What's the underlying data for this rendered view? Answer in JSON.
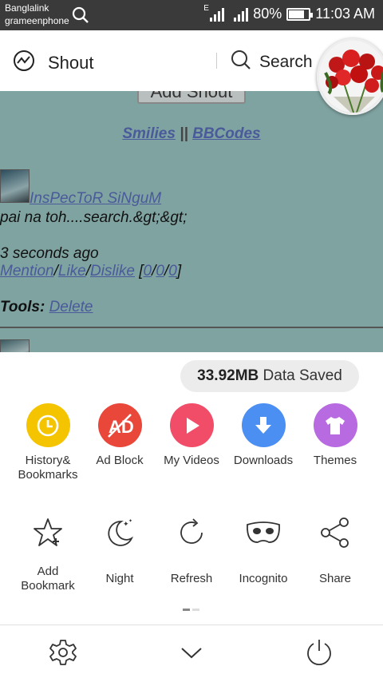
{
  "status_bar": {
    "carrier_1": "Banglalink",
    "carrier_2": "grameenphone",
    "network_type": "E",
    "battery": "80%",
    "battery_level": 0.8,
    "time": "11:03 AM"
  },
  "toolbar": {
    "title": "Shout",
    "search_label": "Search"
  },
  "page": {
    "add_shout_label": "Add Shout",
    "smilies_link": "Smilies",
    "separator": " || ",
    "bbcodes_link": "BBCodes",
    "post": {
      "username": "InsPecToR SiNguM",
      "text": "pai na toh....search.&gt;&gt;",
      "time": "3 seconds ago",
      "mention": "Mention",
      "like": "Like",
      "dislike": "Dislike",
      "slash": "/",
      "open_bracket": " [",
      "close_bracket": "]",
      "count_mention": "0",
      "count_like": "0",
      "count_dislike": "0",
      "tools_label": "Tools:",
      "delete": "Delete"
    }
  },
  "sheet": {
    "data_saved_amount": "33.92MB",
    "data_saved_label": "Data Saved",
    "row1": [
      {
        "label_1": "History&",
        "label_2": "Bookmarks",
        "icon": "clock-icon",
        "color": "#f5c400"
      },
      {
        "label_1": "Ad Block",
        "label_2": "",
        "icon": "ad-block-icon",
        "color": "#e8473a"
      },
      {
        "label_1": "My Videos",
        "label_2": "",
        "icon": "play-icon",
        "color": "#f14d68"
      },
      {
        "label_1": "Downloads",
        "label_2": "",
        "icon": "download-icon",
        "color": "#4c8ff2"
      },
      {
        "label_1": "Themes",
        "label_2": "",
        "icon": "tshirt-icon",
        "color": "#b86ae0"
      }
    ],
    "row2": [
      {
        "label_1": "Add",
        "label_2": "Bookmark",
        "icon": "star-plus-icon"
      },
      {
        "label_1": "Night",
        "label_2": "",
        "icon": "moon-icon"
      },
      {
        "label_1": "Refresh",
        "label_2": "",
        "icon": "refresh-icon"
      },
      {
        "label_1": "Incognito",
        "label_2": "",
        "icon": "mask-icon"
      },
      {
        "label_1": "Share",
        "label_2": "",
        "icon": "share-icon"
      }
    ],
    "bottom_bar": {
      "settings_icon": "gear-icon",
      "collapse_icon": "chevron-down-icon",
      "exit_icon": "power-icon"
    }
  }
}
